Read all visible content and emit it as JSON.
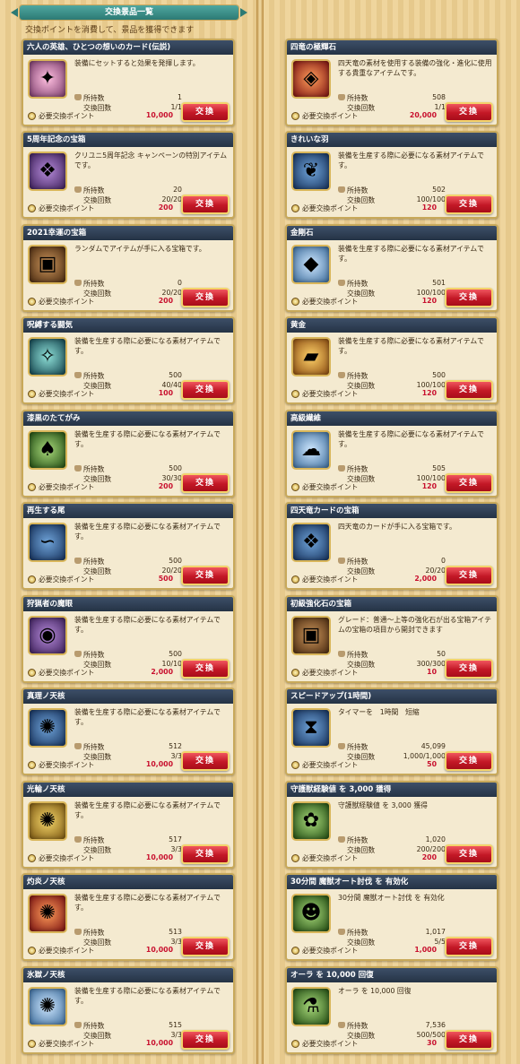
{
  "header": {
    "title": "交換景品一覧",
    "subtitle": "交換ポイントを消費して、景品を獲得できます"
  },
  "labels": {
    "owned": "所持数",
    "count": "交換回数",
    "points": "必要交換ポイント",
    "button": "交換"
  },
  "left": [
    {
      "name": "六人の英雄、ひとつの想いのカード(伝説)",
      "desc": "装備にセットすると効果を発揮します。",
      "owned": "1",
      "count": "1/1",
      "points": "10,000",
      "icon": "hero-card-icon",
      "glyph": "✦",
      "cls": "i-pink"
    },
    {
      "name": "5周年記念の宝箱",
      "desc": "クリユニ5周年記念\nキャンペーンの特別アイテムです。",
      "owned": "20",
      "count": "20/20",
      "points": "200",
      "icon": "treasure-chest-icon",
      "glyph": "❖",
      "cls": "i-purple"
    },
    {
      "name": "2021幸運の宝箱",
      "desc": "ランダムでアイテムが手に入る宝箱です。",
      "owned": "0",
      "count": "20/20",
      "points": "200",
      "icon": "treasure-chest-icon",
      "glyph": "▣",
      "cls": "i-brown"
    },
    {
      "name": "呪縛する闘気",
      "desc": "装備を生産する際に必要になる素材アイテムです。",
      "owned": "500",
      "count": "40/40",
      "points": "100",
      "icon": "aura-crystal-icon",
      "glyph": "✧",
      "cls": "i-teal"
    },
    {
      "name": "漆黒のたてがみ",
      "desc": "装備を生産する際に必要になる素材アイテムです。",
      "owned": "500",
      "count": "30/30",
      "points": "200",
      "icon": "black-mane-icon",
      "glyph": "♠",
      "cls": "i-green"
    },
    {
      "name": "再生する尾",
      "desc": "装備を生産する際に必要になる素材アイテムです。",
      "owned": "500",
      "count": "20/20",
      "points": "500",
      "icon": "tail-icon",
      "glyph": "∽",
      "cls": "i-blue"
    },
    {
      "name": "狩猟者の魔眼",
      "desc": "装備を生産する際に必要になる素材アイテムです。",
      "owned": "500",
      "count": "10/10",
      "points": "2,000",
      "icon": "magic-eye-icon",
      "glyph": "◉",
      "cls": "i-purple"
    },
    {
      "name": "真理ノ天核",
      "desc": "装備を生産する際に必要になる素材アイテムです。",
      "owned": "512",
      "count": "3/3",
      "points": "10,000",
      "icon": "truth-core-icon",
      "glyph": "✺",
      "cls": "i-blue"
    },
    {
      "name": "光輪ノ天核",
      "desc": "装備を生産する際に必要になる素材アイテムです。",
      "owned": "517",
      "count": "3/3",
      "points": "10,000",
      "icon": "halo-core-icon",
      "glyph": "✺",
      "cls": "i-yellow"
    },
    {
      "name": "灼炎ノ天核",
      "desc": "装備を生産する際に必要になる素材アイテムです。",
      "owned": "513",
      "count": "3/3",
      "points": "10,000",
      "icon": "flame-core-icon",
      "glyph": "✺",
      "cls": "i-red"
    },
    {
      "name": "氷獄ノ天核",
      "desc": "装備を生産する際に必要になる素材アイテムです。",
      "owned": "515",
      "count": "3/3",
      "points": "10,000",
      "icon": "ice-core-icon",
      "glyph": "✺",
      "cls": "i-sky"
    }
  ],
  "right": [
    {
      "name": "四竜の極輝石",
      "desc": "四天竜の素材を使用する装備の強化・進化に使用する貴重なアイテムです。",
      "owned": "508",
      "count": "1/1",
      "points": "20,000",
      "icon": "dragon-stone-icon",
      "glyph": "◈",
      "cls": "i-red"
    },
    {
      "name": "きれいな羽",
      "desc": "装備を生産する際に必要になる素材アイテムです。",
      "owned": "502",
      "count": "100/100",
      "points": "120",
      "icon": "feather-icon",
      "glyph": "❦",
      "cls": "i-blue"
    },
    {
      "name": "金剛石",
      "desc": "装備を生産する際に必要になる素材アイテムです。",
      "owned": "501",
      "count": "100/100",
      "points": "120",
      "icon": "diamond-icon",
      "glyph": "◆",
      "cls": "i-sky"
    },
    {
      "name": "黄金",
      "desc": "装備を生産する際に必要になる素材アイテムです。",
      "owned": "500",
      "count": "100/100",
      "points": "120",
      "icon": "gold-ingot-icon",
      "glyph": "▰",
      "cls": "i-gold"
    },
    {
      "name": "高級繊維",
      "desc": "装備を生産する際に必要になる素材アイテムです。",
      "owned": "505",
      "count": "100/100",
      "points": "120",
      "icon": "fiber-icon",
      "glyph": "☁",
      "cls": "i-sky"
    },
    {
      "name": "四天竜カードの宝箱",
      "desc": "四天竜のカードが手に入る宝箱です。",
      "owned": "0",
      "count": "20/20",
      "points": "2,000",
      "icon": "dragon-chest-icon",
      "glyph": "❖",
      "cls": "i-blue"
    },
    {
      "name": "初級強化石の宝箱",
      "desc": "グレード：普通～上等の強化石が出る宝箱アイテムの宝箱の項目から開封できます",
      "owned": "50",
      "count": "300/300",
      "points": "10",
      "icon": "enhance-chest-icon",
      "glyph": "▣",
      "cls": "i-brown"
    },
    {
      "name": "スピードアップ(1時間)",
      "desc": "タイマーを　1時間　短縮",
      "owned": "45,099",
      "count": "1,000/1,000",
      "points": "50",
      "icon": "hourglass-icon",
      "glyph": "⧗",
      "cls": "i-blue"
    },
    {
      "name": "守護獣経験値 を 3,000 獲得",
      "desc": "守護獣経験値 を 3,000 獲得",
      "owned": "1,020",
      "count": "200/200",
      "points": "200",
      "icon": "guardian-exp-icon",
      "glyph": "✿",
      "cls": "i-green"
    },
    {
      "name": "30分間 魔獣オート討伐 を 有効化",
      "desc": "30分間 魔獣オート討伐 を 有効化",
      "owned": "1,017",
      "count": "5/5",
      "points": "1,000",
      "icon": "auto-hunt-icon",
      "glyph": "☻",
      "cls": "i-green"
    },
    {
      "name": "オーラ を 10,000 回復",
      "desc": "オーラ を 10,000 回復",
      "owned": "7,536",
      "count": "500/500",
      "points": "30",
      "icon": "aura-potion-icon",
      "glyph": "⚗",
      "cls": "i-green"
    }
  ]
}
